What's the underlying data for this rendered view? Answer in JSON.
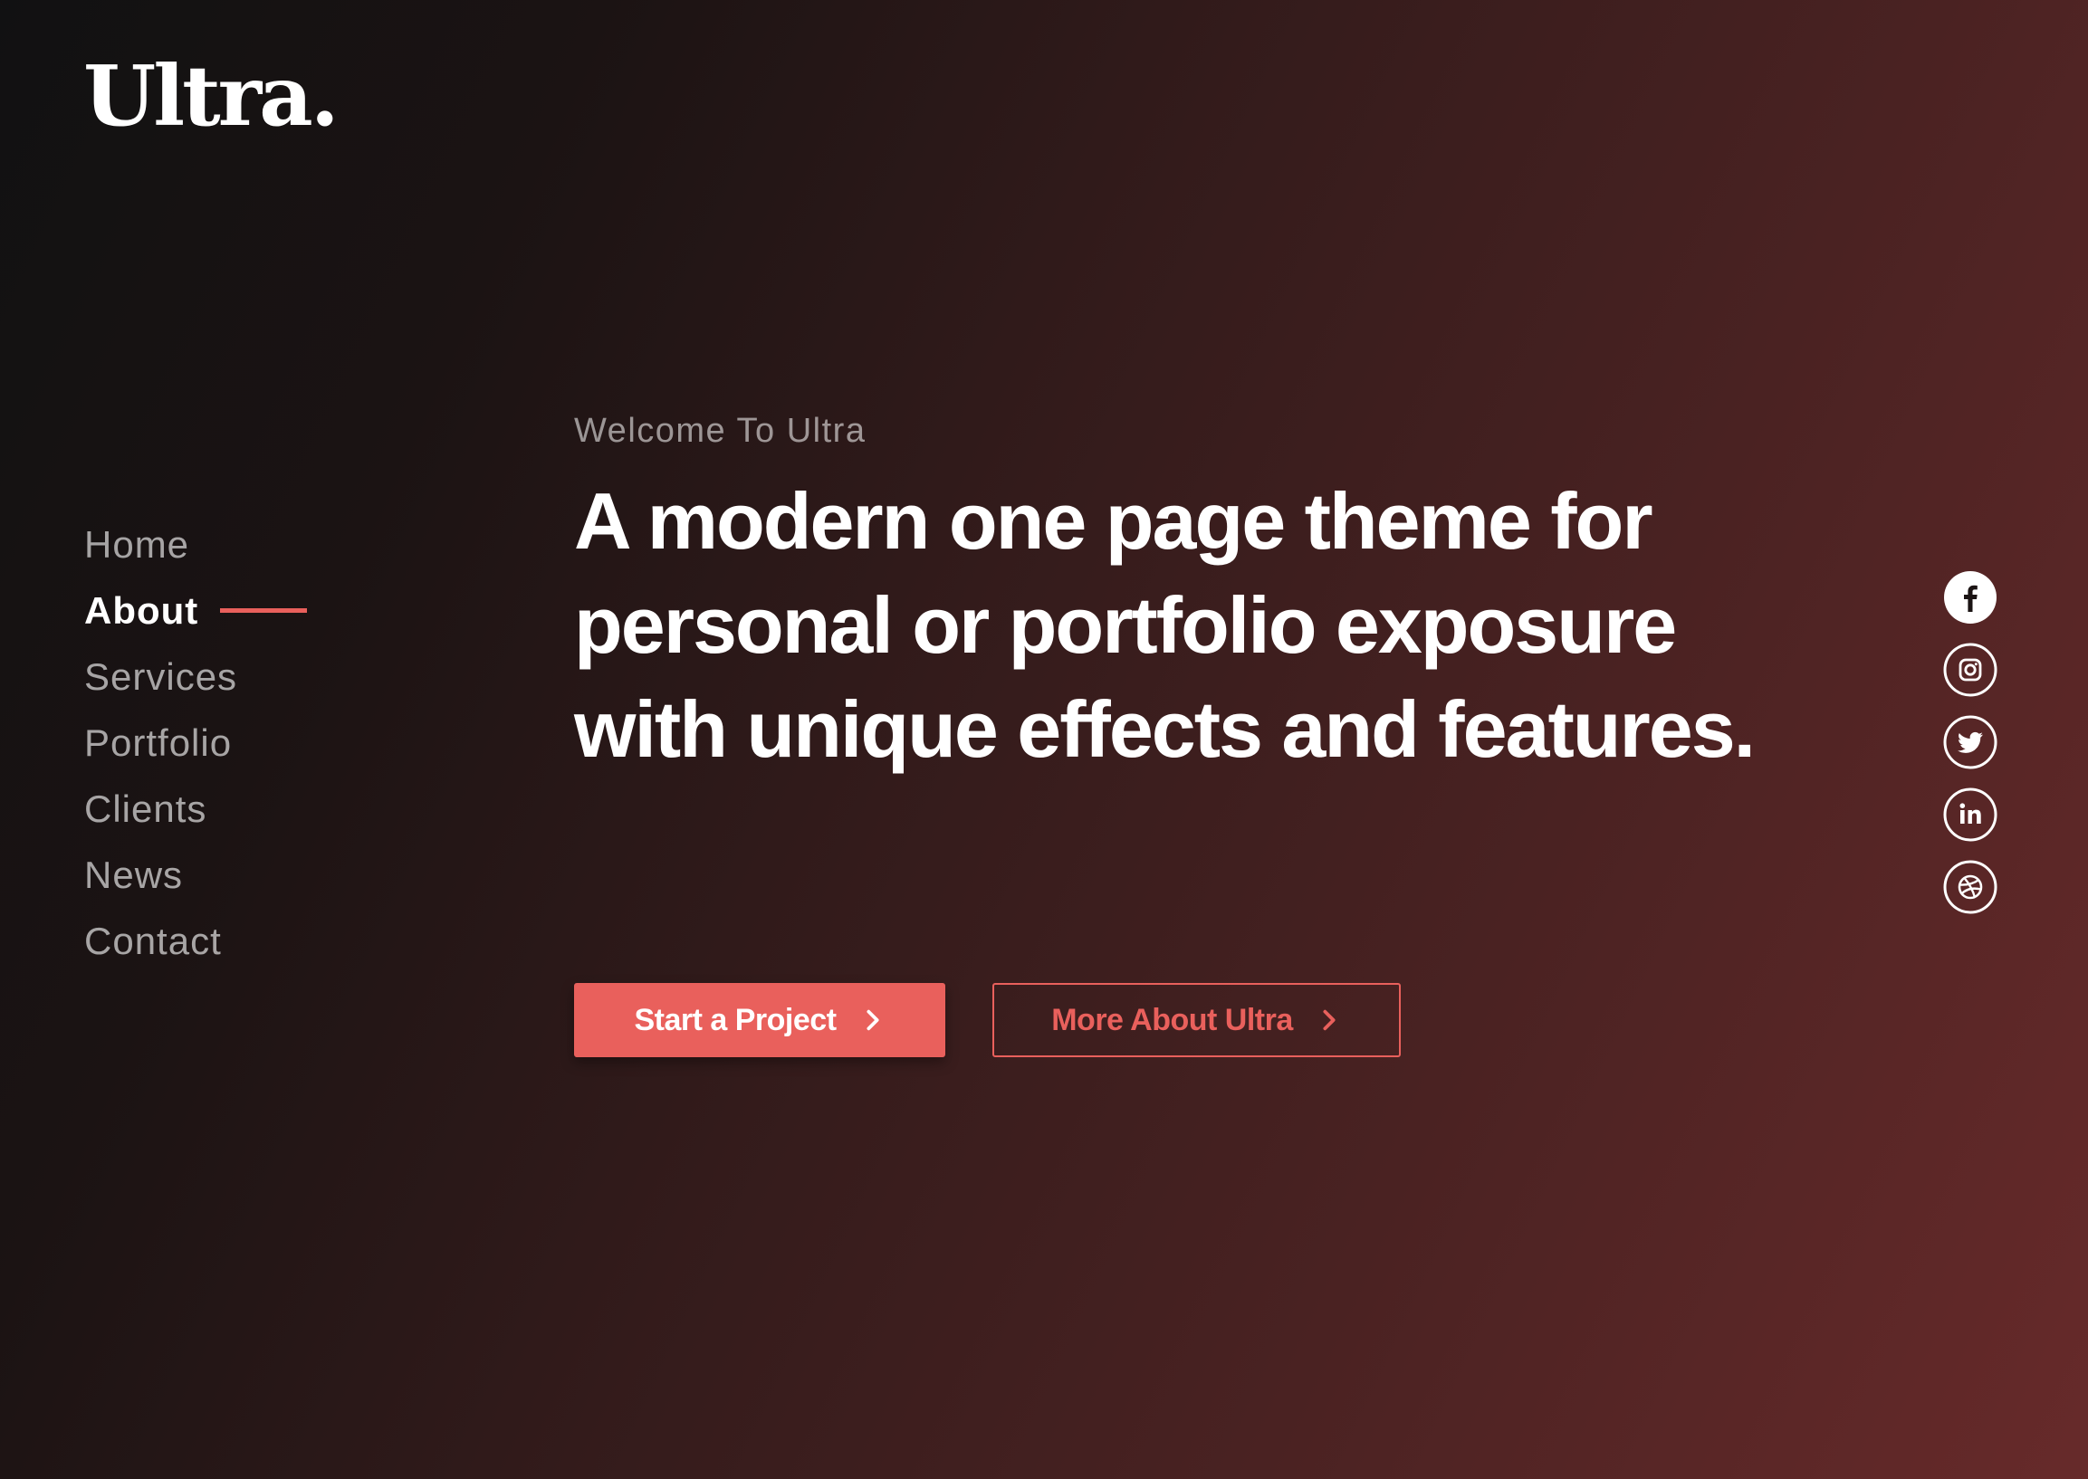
{
  "brand": {
    "logo_text": "Ultra."
  },
  "nav": {
    "items": [
      {
        "label": "Home"
      },
      {
        "label": "About"
      },
      {
        "label": "Services"
      },
      {
        "label": "Portfolio"
      },
      {
        "label": "Clients"
      },
      {
        "label": "News"
      },
      {
        "label": "Contact"
      }
    ],
    "active": "About"
  },
  "hero": {
    "welcome": "Welcome To Ultra",
    "headline": "A modern one page theme for personal or portfolio exposure with unique effects and features.",
    "primary_button": "Start a Project",
    "secondary_button": "More About Ultra"
  },
  "social": [
    {
      "icon": "facebook-icon"
    },
    {
      "icon": "instagram-icon"
    },
    {
      "icon": "twitter-icon"
    },
    {
      "icon": "linkedin-icon"
    },
    {
      "icon": "dribbble-icon"
    }
  ],
  "colors": {
    "accent": "#e9605c",
    "background_dark": "#111112",
    "background_red": "#672a2a"
  }
}
